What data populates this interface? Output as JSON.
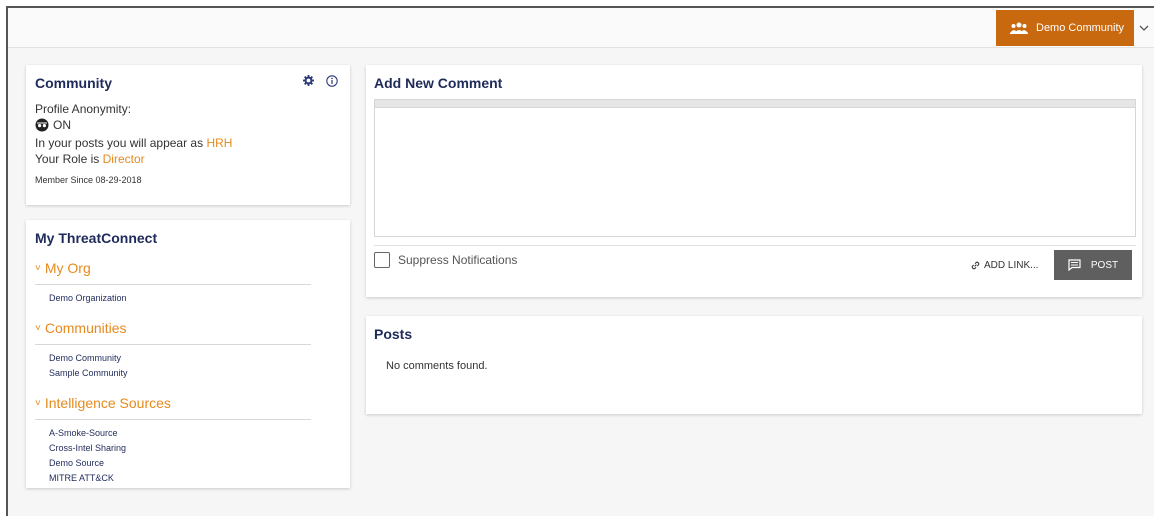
{
  "topbar": {
    "community_label": "Demo Community",
    "community_icon": "users-icon",
    "accent": "#c9690f"
  },
  "community": {
    "title": "Community",
    "profile_anonymity_label": "Profile Anonymity:",
    "anonymity_state": "ON",
    "appear_as_prefix": "In your posts you will appear as",
    "appear_as_value": "HRH",
    "role_prefix": "Your Role is",
    "role_value": "Director",
    "member_since": "Member Since 08-29-2018"
  },
  "my_threatconnect": {
    "title": "My ThreatConnect",
    "sections": [
      {
        "label": "My Org",
        "items": [
          "Demo Organization"
        ]
      },
      {
        "label": "Communities",
        "items": [
          "Demo Community",
          "Sample Community"
        ]
      },
      {
        "label": "Intelligence Sources",
        "items": [
          "A-Smoke-Source",
          "Cross-Intel Sharing",
          "Demo Source",
          "MITRE ATT&CK"
        ]
      }
    ]
  },
  "add_comment": {
    "title": "Add New Comment",
    "suppress_label": "Suppress Notifications",
    "add_link_label": "ADD LINK...",
    "post_label": "POST"
  },
  "posts": {
    "title": "Posts",
    "empty_text": "No comments found."
  }
}
